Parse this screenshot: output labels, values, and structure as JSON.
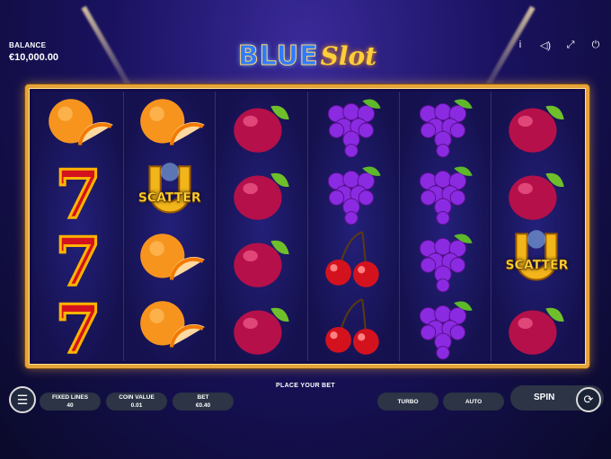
{
  "balance": {
    "label": "BALANCE",
    "value": "€10,000.00"
  },
  "logo": {
    "part1": "BLUE",
    "part2": "Slot"
  },
  "top_icons": [
    "info-icon",
    "sound-icon",
    "fullscreen-icon",
    "power-icon"
  ],
  "reels": [
    [
      "orange",
      "seven",
      "seven",
      "seven"
    ],
    [
      "orange",
      "horseshoe",
      "orange",
      "orange"
    ],
    [
      "plum",
      "plum",
      "plum",
      "plum"
    ],
    [
      "grapes",
      "grapes",
      "cherries",
      "cherries"
    ],
    [
      "grapes",
      "grapes",
      "grapes",
      "grapes"
    ],
    [
      "plum",
      "plum",
      "horseshoe",
      "plum"
    ]
  ],
  "scatter_text": "SCATTER",
  "controls": {
    "place_bet": "PLACE YOUR BET",
    "fixed_lines_label": "FIXED LINES",
    "fixed_lines_value": "40",
    "coin_value_label": "COIN VALUE",
    "coin_value_value": "0.01",
    "bet_label": "BET",
    "bet_value": "€0.40",
    "turbo": "TURBO",
    "auto": "AUTO",
    "spin": "SPIN"
  },
  "colors": {
    "frame": "#e5a43a",
    "scatter": "#ffd53a",
    "accent_blue": "#2f7bff"
  }
}
